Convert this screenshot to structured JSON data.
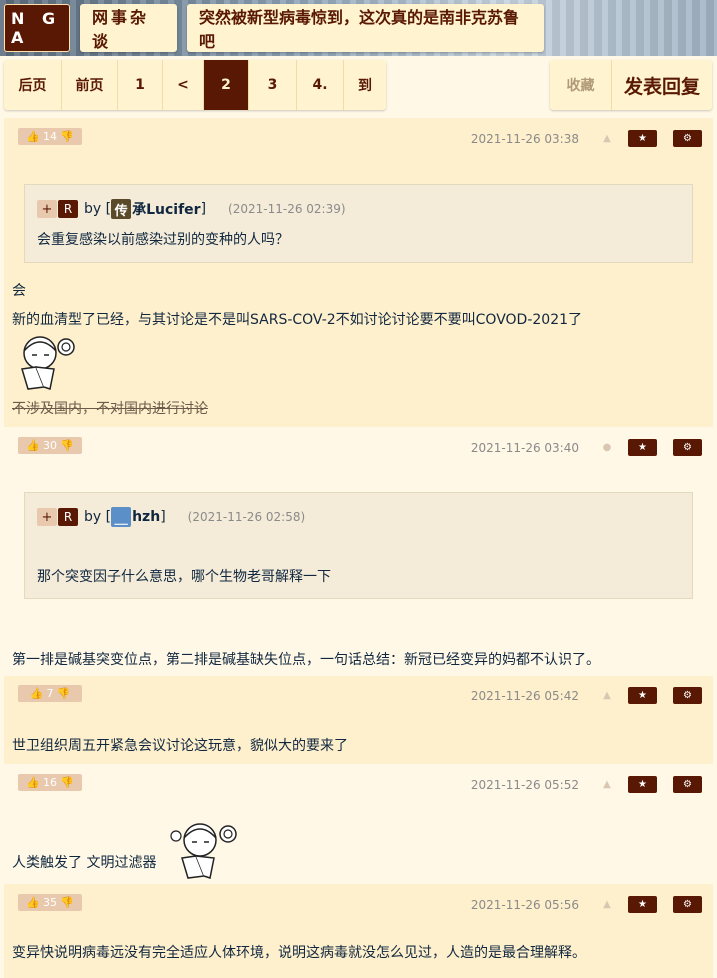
{
  "header": {
    "logo": "N G A",
    "board": "网事杂谈",
    "topic": "突然被新型病毒惊到，这次真的是南非克苏鲁吧"
  },
  "pager": {
    "items": [
      "后页",
      "前页",
      "1",
      "<",
      "2",
      "3",
      "4.",
      "到"
    ],
    "current": "2"
  },
  "actions": {
    "favorite": "收藏",
    "reply": "发表回复"
  },
  "posts": [
    {
      "votes": "14",
      "date": "2021-11-26 03:38",
      "device": "android",
      "quote": {
        "plus": "+",
        "r": "R",
        "by": "by",
        "avatar_char": "传",
        "name": "承Lucifer",
        "time": "(2021-11-26 02:39)",
        "text": "会重复感染以前感染过别的变种的人吗？"
      },
      "lines": [
        "会",
        "新的血清型了已经，与其讨论是不是叫SARS-COV-2不如讨论讨论要不要叫COVOD-2021了"
      ],
      "strike": "不涉及国内，不对国内进行讨论"
    },
    {
      "votes": "30",
      "date": "2021-11-26 03:40",
      "device": "apple",
      "quote": {
        "plus": "+",
        "r": "R",
        "by": "by",
        "avatar_char": "＿",
        "name": "hzh",
        "time": "(2021-11-26 02:58)",
        "text": "那个突变因子什么意思，哪个生物老哥解释一下"
      },
      "lines": [
        "第一排是碱基突变位点，第二排是碱基缺失位点，一句话总结：新冠已经变异的妈都不认识了。"
      ]
    },
    {
      "votes": "7",
      "date": "2021-11-26 05:42",
      "device": "android",
      "lines": [
        "世卫组织周五开紧急会议讨论这玩意，貌似大的要来了"
      ]
    },
    {
      "votes": "16",
      "date": "2021-11-26 05:52",
      "device": "android",
      "lines": [
        "人类触发了 文明过滤器"
      ]
    },
    {
      "votes": "35",
      "date": "2021-11-26 05:56",
      "device": "android",
      "lines": [
        "变异快说明病毒远没有完全适应人体环境，说明这病毒就没怎么见过，人造的是最合理解释。"
      ]
    }
  ],
  "buttons": {
    "star": "★",
    "gear": "⚙"
  }
}
